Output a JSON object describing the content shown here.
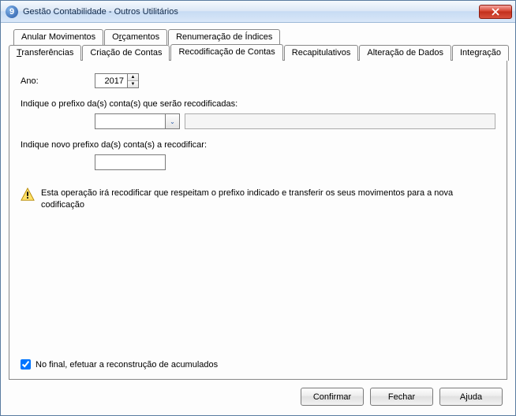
{
  "window": {
    "icon_text": "9",
    "title": "Gestão Contabilidade - Outros Utilitários"
  },
  "tabs_top": [
    {
      "prefix": "",
      "accel": "",
      "label": "Anular Movimentos"
    },
    {
      "prefix": "O",
      "accel": "r",
      "label": "çamentos"
    },
    {
      "prefix": "",
      "accel": "",
      "label": "Renumeração de Índices"
    }
  ],
  "tabs_bottom": [
    {
      "prefix": "",
      "accel": "T",
      "label": "ransferências"
    },
    {
      "prefix": "",
      "accel": "",
      "label": "Criação de Contas"
    },
    {
      "prefix": "",
      "accel": "",
      "label": "Recodificação de Contas"
    },
    {
      "prefix": "",
      "accel": "",
      "label": "Recapitulativos"
    },
    {
      "prefix": "",
      "accel": "",
      "label": "Alteração de Dados"
    },
    {
      "prefix": "",
      "accel": "",
      "label": "Integração"
    }
  ],
  "active_tab_label": "Recodificação de Contas",
  "panel": {
    "ano_label": "Ano:",
    "ano_value": "2017",
    "prefix_old_label": "Indique o prefixo da(s) conta(s) que serão recodificadas:",
    "prefix_old_value": "",
    "display_value": "",
    "prefix_new_label": "Indique novo prefixo da(s) conta(s) a recodificar:",
    "prefix_new_value": "",
    "warning_text": "Esta operação irá recodificar que respeitam o prefixo indicado e transferir os seus movimentos para a nova codificação",
    "checkbox_label": "No final, efetuar a reconstrução de acumulados",
    "checkbox_checked": true
  },
  "buttons": {
    "confirm_prefix": "",
    "confirm_accel": "C",
    "confirm_label": "onfirmar",
    "close_prefix": "",
    "close_accel": "F",
    "close_label": "echar",
    "help_prefix": "",
    "help_accel": "A",
    "help_label": "juda"
  }
}
